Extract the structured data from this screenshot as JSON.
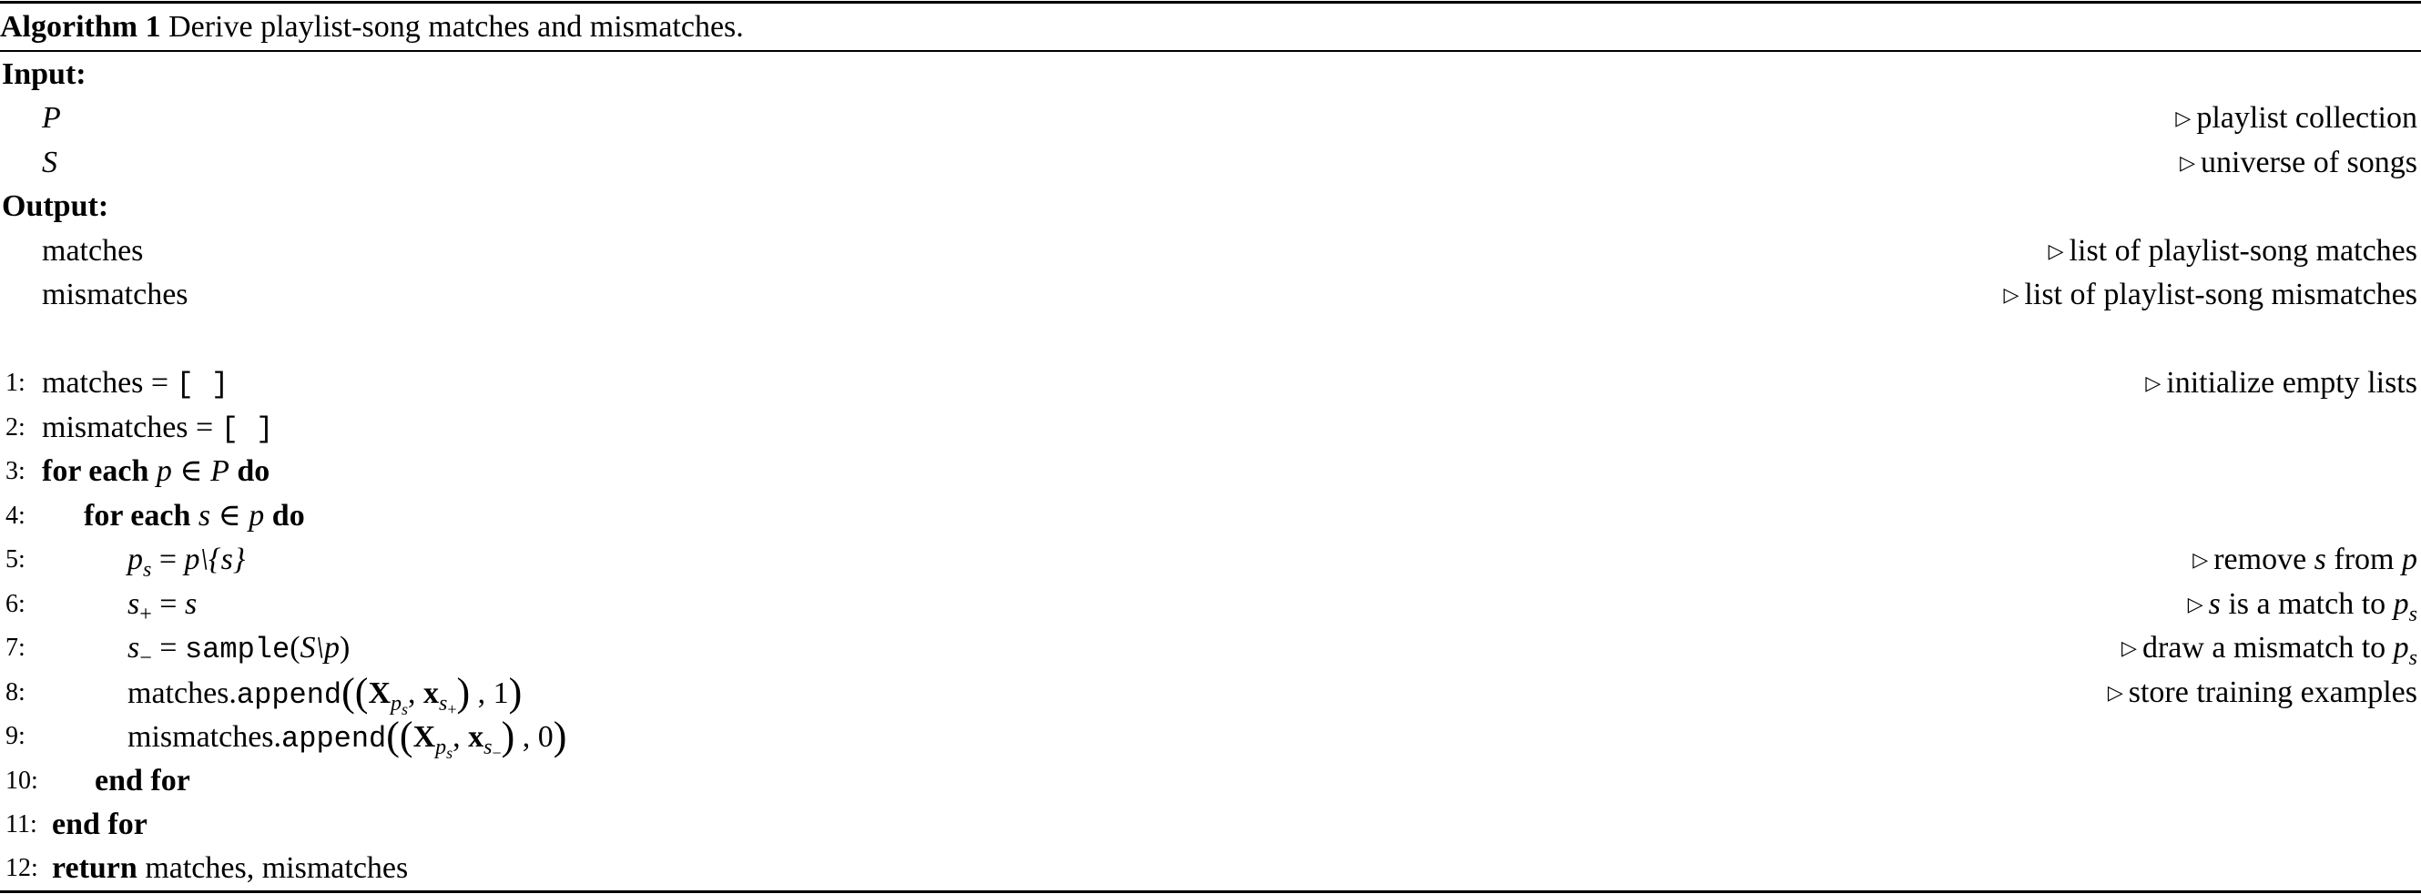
{
  "algorithm": {
    "label": "Algorithm 1",
    "caption": "Derive playlist-song matches and mismatches."
  },
  "input": {
    "heading": "Input:",
    "items": [
      {
        "symbol": "P",
        "comment": "playlist collection"
      },
      {
        "symbol": "S",
        "comment": "universe of songs"
      }
    ]
  },
  "output": {
    "heading": "Output:",
    "items": [
      {
        "symbol": "matches",
        "comment": "list of playlist-song matches"
      },
      {
        "symbol": "mismatches",
        "comment": "list of playlist-song mismatches"
      }
    ]
  },
  "comment_marker": "▷",
  "lines": [
    {
      "num": "1:",
      "comment": "initialize empty lists",
      "text": {
        "var": "matches",
        "eq": "=",
        "val": "[ ]"
      }
    },
    {
      "num": "2:",
      "text": {
        "var": "mismatches",
        "eq": "=",
        "val": "[ ]"
      }
    },
    {
      "num": "3:",
      "text": {
        "kw1": "for each",
        "a": "p",
        "op": "∈",
        "b": "P",
        "kw2": "do"
      }
    },
    {
      "num": "4:",
      "text": {
        "kw1": "for each",
        "a": "s",
        "op": "∈",
        "b": "p",
        "kw2": "do"
      }
    },
    {
      "num": "5:",
      "comment_parts": [
        "remove",
        "s",
        "from",
        "p"
      ],
      "text": {
        "lhs": "p",
        "lhs_sub": "s",
        "eq": "=",
        "rhs": "p\\{s}"
      }
    },
    {
      "num": "6:",
      "comment_parts": [
        "s",
        "is a match to",
        "p",
        "s"
      ],
      "text": {
        "lhs": "s",
        "lhs_sub": "+",
        "eq": "=",
        "rhs": "s"
      }
    },
    {
      "num": "7:",
      "comment_parts": [
        "draw a mismatch to",
        "p",
        "s"
      ],
      "text": {
        "lhs": "s",
        "lhs_sub": "−",
        "eq": "=",
        "fn": "sample",
        "arg": "S\\p"
      }
    },
    {
      "num": "8:",
      "comment": "store training examples",
      "text": {
        "obj": "matches.",
        "method": "append",
        "X": "X",
        "X_sub": "p",
        "X_subsub": "s",
        "x": "x",
        "x_sub": "s",
        "x_subsub": "+",
        "label": "1"
      }
    },
    {
      "num": "9:",
      "text": {
        "obj": "mismatches.",
        "method": "append",
        "X": "X",
        "X_sub": "p",
        "X_subsub": "s",
        "x": "x",
        "x_sub": "s",
        "x_subsub": "−",
        "label": "0"
      }
    },
    {
      "num": "10:",
      "text": {
        "kw": "end for"
      }
    },
    {
      "num": "11:",
      "text": {
        "kw": "end for"
      }
    },
    {
      "num": "12:",
      "text": {
        "kw": "return",
        "rest": "matches, mismatches"
      }
    }
  ]
}
